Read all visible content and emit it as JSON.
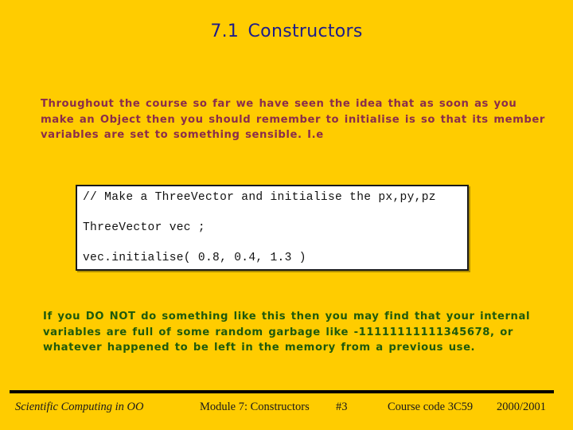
{
  "slide": {
    "title": "7.1  Constructors",
    "intro_lines": [
      "Throughout the course so far we have seen the idea that as soon as you",
      "make an Object  then you should remember to initialise is so that its member",
      "variables are set to something sensible. I.e"
    ],
    "code_lines": [
      "// Make a ThreeVector and initialise the px,py,pz",
      "ThreeVector vec ;",
      "vec.initialise( 0.8, 0.4, 1.3 )"
    ],
    "warning_lines": [
      "If you DO NOT do something like this then you may find that your internal",
      "variables are full of some random garbage like -11111111111345678, or",
      "whatever happened to be left in the memory from a previous use."
    ]
  },
  "footer": {
    "course_name": "Scientific Computing in OO",
    "module": "Module 7: Constructors",
    "slide_number": "#3",
    "course_code": "Course code 3C59",
    "year": "2000/2001"
  },
  "colors": {
    "background": "#FFCC00",
    "title": "#1C1C8A",
    "intro_text": "#8A2D4B",
    "warning_text": "#1F5A0C"
  }
}
